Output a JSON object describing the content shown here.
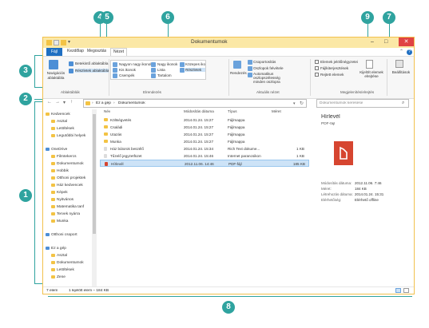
{
  "window": {
    "title": "Dokumentumok",
    "controls": {
      "minimize": "–",
      "maximize": "□",
      "close": "✕"
    }
  },
  "tabs": [
    {
      "label": "Fájl"
    },
    {
      "label": "Kezdőlap"
    },
    {
      "label": "Megosztás"
    },
    {
      "label": "Nézet"
    }
  ],
  "ribbon": {
    "pane_group": {
      "navigation_pane_label": "Navigációs ablaktábla",
      "group_label": "Ablaktáblák",
      "preview_label": "Betekintő ablaktábla",
      "details_label": "Részletek ablaktábla"
    },
    "layout_group": {
      "items": [
        "Nagyon nagy ikonok",
        "Nagy ikonok",
        "Közepes ikonok",
        "Kis ikonok",
        "Lista",
        "Részletek",
        "Csempék",
        "Tartalom"
      ],
      "group_label": "Elrendezés"
    },
    "view_group": {
      "sort_label": "Rendezés",
      "group_by": "Csoportosítás",
      "add_columns": "Oszlopok felvétele",
      "fit_columns": "Automatikus oszlopszélesség minden oszlopra",
      "group_label": "Aktuális nézet"
    },
    "show_group": {
      "item_checkboxes": "Elemek jelölőnégyzetei",
      "file_extensions": "Fájlkiterjesztések",
      "hidden_items": "Rejtett elemek",
      "hide_selected": "Kijelölt elemek elrejtése",
      "group_label": "Megjelenítés/elrejtés"
    },
    "options_label": "Beállítások"
  },
  "address": {
    "path": [
      "Ez a gép",
      "Dokumentumok"
    ],
    "search_placeholder": "Dokumentumok keresése"
  },
  "nav_pane": {
    "items": [
      {
        "label": "Kedvencek",
        "type": "header"
      },
      {
        "label": "Asztal"
      },
      {
        "label": "Letöltések"
      },
      {
        "label": "Legutóbbi helyek"
      },
      {
        "label": "OneDrive",
        "type": "header"
      },
      {
        "label": "Filmtekercs"
      },
      {
        "label": "Dokumentumok"
      },
      {
        "label": "Hobbik"
      },
      {
        "label": "Otthoni projektek"
      },
      {
        "label": "Ház kedvencek"
      },
      {
        "label": "Képek"
      },
      {
        "label": "Nyitvános"
      },
      {
        "label": "Matematika tanf"
      },
      {
        "label": "Tervek nyárra"
      },
      {
        "label": "Munka"
      },
      {
        "label": "Otthoni csoport",
        "type": "header"
      },
      {
        "label": "Ez a gép",
        "type": "header"
      },
      {
        "label": "Asztal"
      },
      {
        "label": "Dokumentumok"
      },
      {
        "label": "Letöltések"
      },
      {
        "label": "Zene"
      }
    ]
  },
  "files": {
    "columns": [
      "Név",
      "Módosítás dátuma",
      "Típus",
      "Méret"
    ],
    "rows": [
      {
        "name": "Költségvetés",
        "date": "2014.01.24. 15:27",
        "type": "Fájlmappa",
        "size": ""
      },
      {
        "name": "Családi",
        "date": "2014.01.24. 15:27",
        "type": "Fájlmappa",
        "size": ""
      },
      {
        "name": "Utazás",
        "date": "2014.01.24. 15:27",
        "type": "Fájlmappa",
        "size": ""
      },
      {
        "name": "Munka",
        "date": "2014.01.24. 15:27",
        "type": "Fájlmappa",
        "size": ""
      },
      {
        "name": "Ház bútorok beszélő",
        "date": "2014.01.24. 15:34",
        "type": "Rich Text dokume...",
        "size": "1 KB"
      },
      {
        "name": "Tűzelő jegyzetfüzet",
        "date": "2014.01.24. 15:46",
        "type": "Internet parancsikon",
        "size": "1 KB"
      },
      {
        "name": "Hírlevél",
        "date": "2012.11.06. 14:46",
        "type": "PDF-fájl",
        "size": "185 KB"
      }
    ],
    "selected_index": 6
  },
  "details": {
    "name": "Hírlevél",
    "type": "PDF-fájl",
    "fields": [
      {
        "label": "Módosítás dátuma:",
        "value": "2012.11.06. 7:46"
      },
      {
        "label": "Méret:",
        "value": "184 KB"
      },
      {
        "label": "Létrehozás dátuma:",
        "value": "2014.01.24. 15:31"
      },
      {
        "label": "Elérhetőség:",
        "value": "Elérhető offline"
      }
    ]
  },
  "status": {
    "count": "7 elem",
    "selected": "1 kijelölt elem – 184 KB"
  },
  "callouts": [
    "1",
    "2",
    "3",
    "4",
    "5",
    "6",
    "7",
    "8",
    "9"
  ],
  "colors": {
    "accent": "#2fa39f",
    "file_tab": "#1f6fc2",
    "title_bar": "#fbe8a6",
    "close": "#e04343"
  }
}
